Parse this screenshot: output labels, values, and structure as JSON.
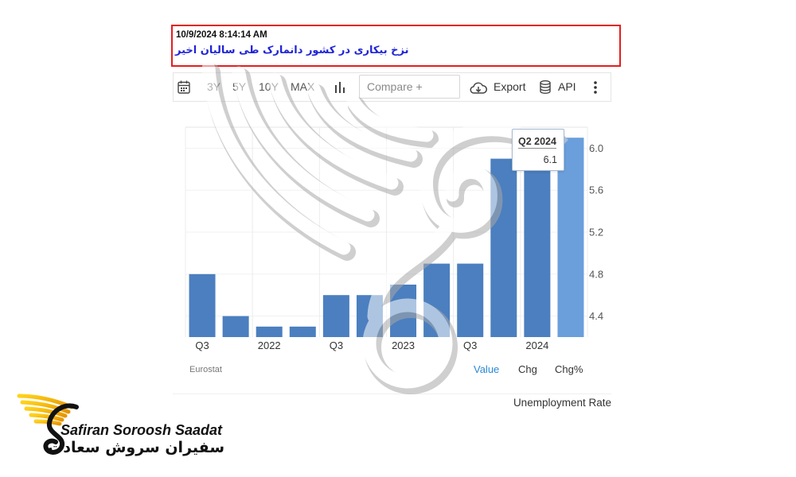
{
  "header": {
    "timestamp": "10/9/2024 8:14:14 AM",
    "caption": "نزخ بیکاری در کشور دانمارک طی سالیان اخیر",
    "border_color": "#e41e1e",
    "caption_color": "#1f24d8"
  },
  "toolbar": {
    "calendar_icon": "calendar-icon",
    "ranges": [
      "3Y",
      "5Y",
      "10Y",
      "MAX"
    ],
    "chart_type_icon": "bar-chart-icon",
    "compare_placeholder": "Compare +",
    "export_icon": "cloud-download-icon",
    "export_label": "Export",
    "api_icon": "database-icon",
    "api_label": "API",
    "more_icon": "vertical-dots-icon"
  },
  "chart_data": {
    "type": "bar",
    "categories": [
      "Q3",
      "",
      "2022",
      "",
      "Q3",
      "",
      "2023",
      "",
      "Q3",
      "",
      "2024",
      ""
    ],
    "values": [
      4.8,
      4.4,
      4.3,
      4.3,
      4.6,
      4.6,
      4.7,
      4.9,
      4.9,
      5.9,
      5.9,
      6.1
    ],
    "ylim": [
      4.2,
      6.2
    ],
    "yticks": [
      4.4,
      4.8,
      5.2,
      5.6,
      6.0
    ],
    "ytick_labels": [
      "4.4",
      "4.8",
      "5.2",
      "5.6",
      "6.0"
    ],
    "y_axis_side": "right",
    "grid": true,
    "bar_color": "#4b7fbf",
    "highlight_color": "#6a9fdc",
    "hover_index": 11,
    "tooltip": {
      "title": "Q2 2024",
      "value": "6.1"
    },
    "source": "Eurostat"
  },
  "view_tabs": [
    {
      "label": "Value",
      "active": true
    },
    {
      "label": "Chg",
      "active": false
    },
    {
      "label": "Chg%",
      "active": false
    }
  ],
  "active_tab_color": "#2b88d8",
  "indicator_name": "Unemployment Rate",
  "brand": {
    "logo_icon": "eagle-wing-logo-icon",
    "name": "Safiran Soroosh Saadat",
    "name_fa": "سفیران سروش سعادت",
    "wing_color": "#f5b400"
  },
  "watermark_icon": "wing-watermark-icon"
}
